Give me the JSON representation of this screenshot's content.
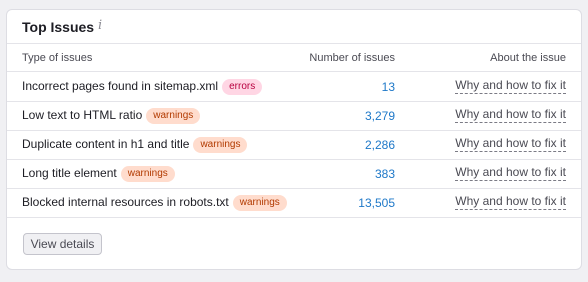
{
  "widget": {
    "title": "Top Issues",
    "info_icon": "info-icon",
    "columns": {
      "type": "Type of issues",
      "count": "Number of issues",
      "about": "About the issue"
    },
    "rows": [
      {
        "name": "Incorrect pages found in sitemap.xml",
        "badge": "errors",
        "count": "13",
        "link": "Why and how to fix it"
      },
      {
        "name": "Low text to HTML ratio",
        "badge": "warnings",
        "count": "3,279",
        "link": "Why and how to fix it"
      },
      {
        "name": "Duplicate content in h1 and title",
        "badge": "warnings",
        "count": "2,286",
        "link": "Why and how to fix it"
      },
      {
        "name": "Long title element",
        "badge": "warnings",
        "count": "383",
        "link": "Why and how to fix it"
      },
      {
        "name": "Blocked internal resources in robots.txt",
        "badge": "warnings",
        "count": "13,505",
        "link": "Why and how to fix it"
      }
    ],
    "view_details_label": "View details"
  },
  "colors": {
    "errors_badge_bg": "#ffd6e4",
    "errors_badge_text": "#b8003f",
    "warnings_badge_bg": "#ffdccd",
    "warnings_badge_text": "#b23a00",
    "count_link": "#1e78c8"
  }
}
